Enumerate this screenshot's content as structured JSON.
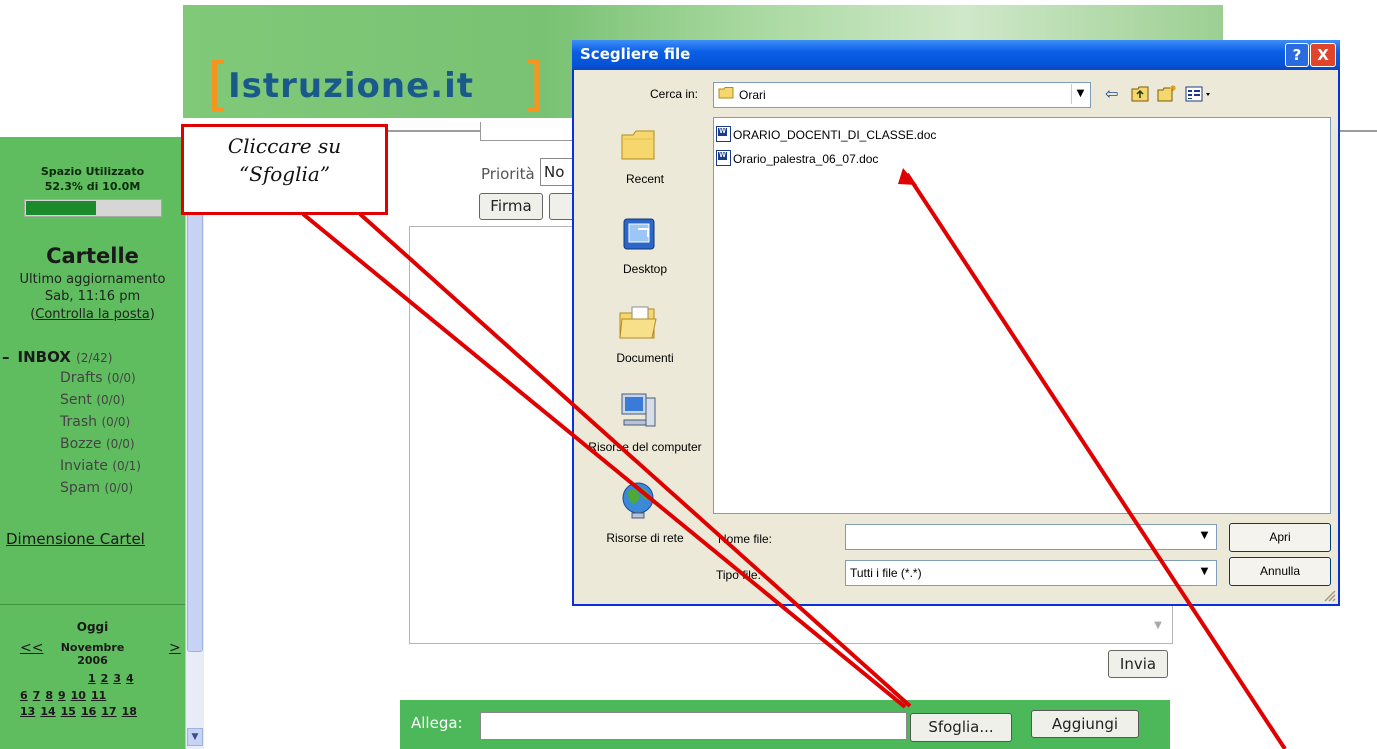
{
  "header": {
    "logo_text": "Istruzione.it",
    "logo_bracket_left": "[",
    "logo_bracket_right": "]"
  },
  "sidebar": {
    "space_title": "Spazio Utilizzato",
    "space_value": "52.3% di 10.0M",
    "space_fraction": 0.523,
    "folders_title": "Cartelle",
    "last_update_label": "Ultimo aggiornamento",
    "last_update_time": "Sab, 11:16 pm",
    "check_mail_prefix": "(",
    "check_mail_link": "Controlla la posta",
    "check_mail_suffix": ")",
    "inbox": {
      "collapse": "–",
      "label": "INBOX",
      "count": "(2/42)"
    },
    "folders": [
      {
        "label": "Drafts",
        "count": "(0/0)"
      },
      {
        "label": "Sent",
        "count": "(0/0)"
      },
      {
        "label": "Trash",
        "count": "(0/0)"
      },
      {
        "label": "Bozze",
        "count": "(0/0)"
      },
      {
        "label": "Inviate",
        "count": "(0/1)"
      },
      {
        "label": "Spam",
        "count": "(0/0)"
      }
    ],
    "folder_size_link": "Dimensione Cartel",
    "calendar": {
      "today": "Oggi",
      "prev": "<<",
      "next": ">",
      "month": "Novembre",
      "year": "2006",
      "rows": [
        [
          "1",
          "2",
          "3",
          "4"
        ],
        [
          "6",
          "7",
          "8",
          "9",
          "10",
          "11"
        ],
        [
          "13",
          "14",
          "15",
          "16",
          "17",
          "18"
        ]
      ]
    }
  },
  "compose": {
    "priority_label": "Priorità",
    "priority_value": "No",
    "firma_button": "Firma",
    "send_button": "Invia",
    "attach_label": "Allega:",
    "browse_button": "Sfoglia...",
    "add_button": "Aggiungi"
  },
  "callout": {
    "line1": "Cliccare su",
    "line2": "“Sfoglia”"
  },
  "dialog": {
    "title": "Scegliere file",
    "help": "?",
    "close": "X",
    "look_in_label": "Cerca in:",
    "look_in_value": "Orari",
    "places": [
      "Recent",
      "Desktop",
      "Documenti",
      "Risorse del computer",
      "Risorse di rete"
    ],
    "files": [
      "ORARIO_DOCENTI_DI_CLASSE.doc",
      "Orario_palestra_06_07.doc"
    ],
    "filename_label": "Nome file:",
    "filename_value": "",
    "filetype_label": "Tipo file:",
    "filetype_value": "Tutti i file (*.*)",
    "open_button": "Apri",
    "cancel_button": "Annulla"
  },
  "colors": {
    "dialog_title": "#0a5ee6",
    "sidebar": "#5fbd5f",
    "attach_bar": "#4cb85a",
    "callout_border": "#e00000",
    "annotation_arrow": "#e00000",
    "logo_orange": "#f7941d",
    "logo_blue": "#1a5a8a"
  }
}
